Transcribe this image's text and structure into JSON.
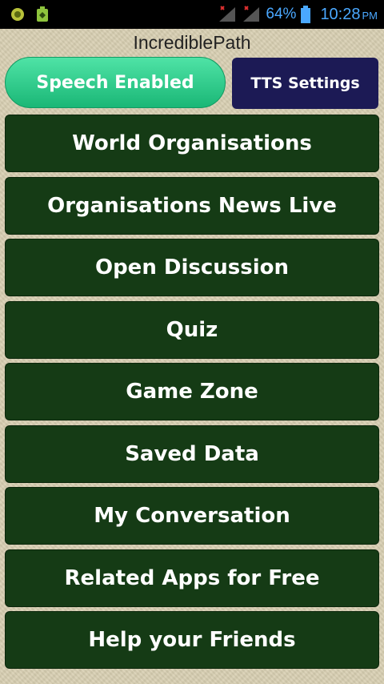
{
  "status_bar": {
    "battery_percent": "64%",
    "time": "10:28",
    "ampm": "PM",
    "icons": [
      "app-notification-icon",
      "android-debug-icon",
      "signal-icon",
      "signal-icon",
      "battery-icon"
    ]
  },
  "app": {
    "title": "IncrediblePath"
  },
  "toolbar": {
    "speech_label": "Speech Enabled",
    "tts_label": "TTS Settings"
  },
  "menu": {
    "items": [
      {
        "label": "World Organisations"
      },
      {
        "label": "Organisations News Live"
      },
      {
        "label": "Open Discussion"
      },
      {
        "label": "Quiz"
      },
      {
        "label": "Game Zone"
      },
      {
        "label": "Saved Data"
      },
      {
        "label": "My Conversation"
      },
      {
        "label": "Related Apps for Free"
      },
      {
        "label": "Help your Friends"
      }
    ]
  },
  "colors": {
    "menu_bg": "#153b15",
    "speech_bg": "#2ccb8a",
    "tts_bg": "#1c1a55",
    "status_accent": "#4aa8ff"
  }
}
